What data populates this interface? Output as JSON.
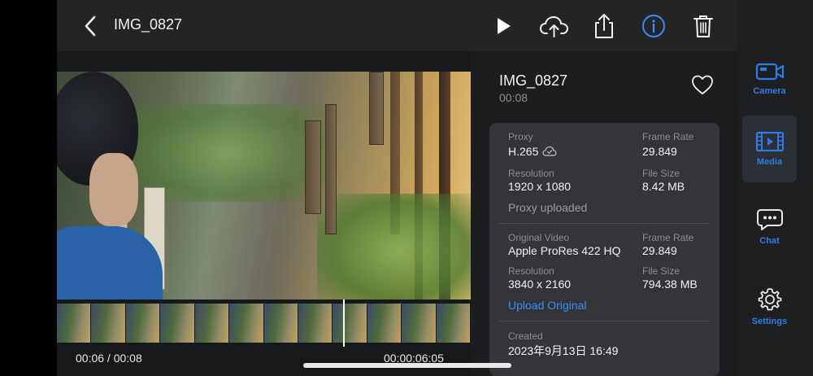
{
  "header": {
    "title": "IMG_0827"
  },
  "clip": {
    "name": "IMG_0827",
    "duration": "00:08"
  },
  "playback": {
    "position": "00:06 / 00:08",
    "timecode": "00:00:06:05"
  },
  "proxy": {
    "proxy_label": "Proxy",
    "proxy_value": "H.265",
    "frame_rate_label": "Frame Rate",
    "frame_rate_value": "29.849",
    "resolution_label": "Resolution",
    "resolution_value": "1920 x 1080",
    "file_size_label": "File Size",
    "file_size_value": "8.42 MB",
    "status": "Proxy uploaded"
  },
  "original": {
    "video_label": "Original Video",
    "video_value": "Apple ProRes 422 HQ",
    "frame_rate_label": "Frame Rate",
    "frame_rate_value": "29.849",
    "resolution_label": "Resolution",
    "resolution_value": "3840 x 2160",
    "file_size_label": "File Size",
    "file_size_value": "794.38 MB",
    "upload_link": "Upload Original"
  },
  "created": {
    "label": "Created",
    "value": "2023年9月13日 16:49"
  },
  "sidebar": {
    "items": [
      {
        "label": "Camera",
        "icon": "camera-icon"
      },
      {
        "label": "Media",
        "icon": "media-icon"
      },
      {
        "label": "Chat",
        "icon": "chat-icon"
      },
      {
        "label": "Settings",
        "icon": "gear-icon"
      }
    ]
  },
  "colors": {
    "accent": "#2f7de4",
    "link": "#3e8ef7",
    "card": "#333538",
    "panel": "#1c1d1f"
  }
}
